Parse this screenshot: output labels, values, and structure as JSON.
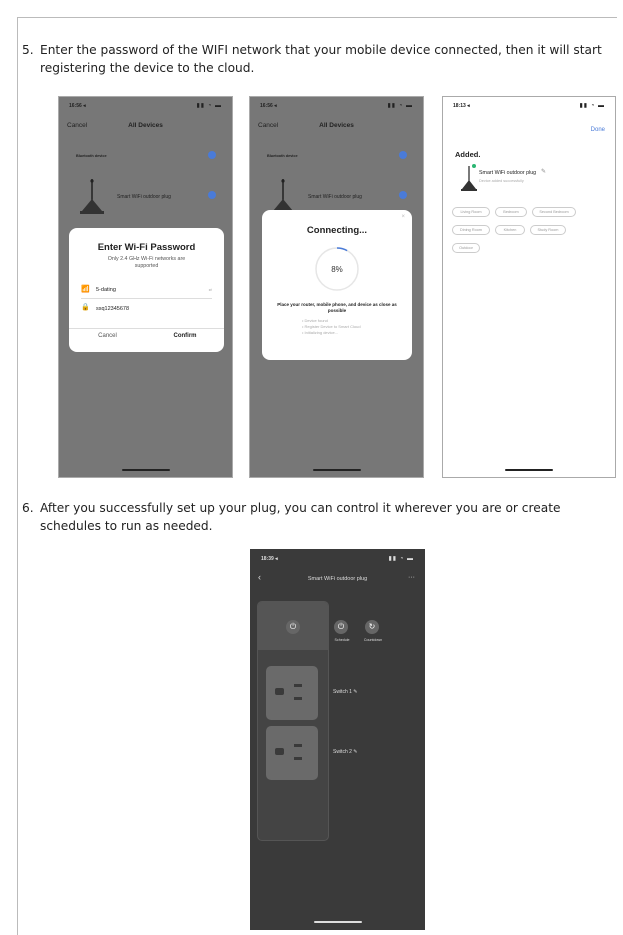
{
  "step5": {
    "number": "5.",
    "text": "Enter the password of the WIFI network that your mobile device connected, then it will start registering the device to the cloud."
  },
  "step6": {
    "number": "6.",
    "text": "After you successfully set up your plug, you can control it wherever you are or create schedules to run as needed."
  },
  "phone1": {
    "time": "16:56",
    "nav_cancel": "Cancel",
    "nav_title": "All Devices",
    "section": "Bluetooth device",
    "device_name": "Smart WiFi outdoor plug",
    "dialog_title": "Enter Wi-Fi Password",
    "dialog_subtitle": "Only 2.4 GHz Wi-Fi networks are supported",
    "wifi_name": "5-dating",
    "password": "ssq12345678",
    "cancel": "Cancel",
    "confirm": "Confirm"
  },
  "phone2": {
    "time": "16:56",
    "nav_cancel": "Cancel",
    "nav_title": "All Devices",
    "section": "Bluetooth device",
    "device_name": "Smart WiFi outdoor plug",
    "dialog_title": "Connecting...",
    "progress": "8%",
    "progress_value": 0.08,
    "hint": "Place your router, mobile phone, and device as close as possible",
    "steps": [
      "Device found",
      "Register Device to Smart Cloud",
      "Initializing device..."
    ]
  },
  "phone3": {
    "time": "18:13",
    "done": "Done",
    "added": "Added.",
    "device_name": "Smart WiFi outdoor plug",
    "device_sub": "Device added successfully",
    "rooms": [
      "Living Room",
      "Bedroom",
      "Second Bedroom",
      "Dining Room",
      "Kitchen",
      "Study Room",
      "Outdoor"
    ]
  },
  "phone4": {
    "time": "18:39",
    "title": "Smart WiFi outdoor plug",
    "more": "···",
    "schedule": "Schedule",
    "countdown": "Countdown",
    "switch1": "Switch 1",
    "switch2": "Switch 2"
  },
  "colors": {
    "accent": "#4a7bd8",
    "dark_bg": "#3a3a3a",
    "gray_overlay": "#7a7a7a"
  }
}
